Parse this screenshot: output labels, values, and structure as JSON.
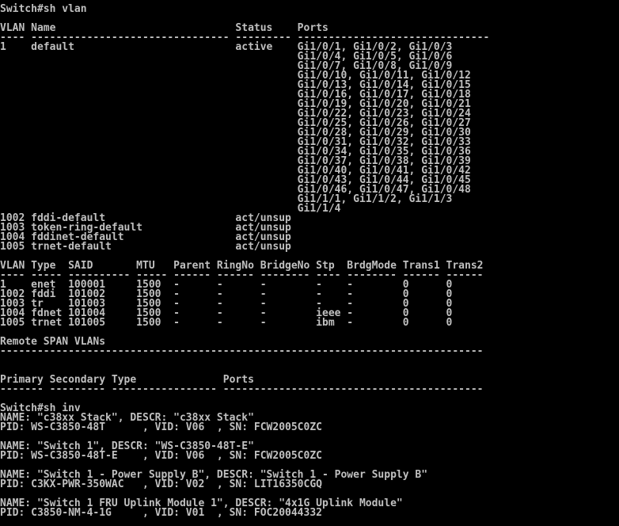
{
  "terminal": {
    "foreground": "#c0c0c0",
    "background": "#000000",
    "lines": [
      "Switch#sh vlan",
      "",
      "VLAN Name                             Status    Ports",
      "---- -------------------------------- --------- -------------------------------",
      "1    default                          active    Gi1/0/1, Gi1/0/2, Gi1/0/3",
      "                                                Gi1/0/4, Gi1/0/5, Gi1/0/6",
      "                                                Gi1/0/7, Gi1/0/8, Gi1/0/9",
      "                                                Gi1/0/10, Gi1/0/11, Gi1/0/12",
      "                                                Gi1/0/13, Gi1/0/14, Gi1/0/15",
      "                                                Gi1/0/16, Gi1/0/17, Gi1/0/18",
      "                                                Gi1/0/19, Gi1/0/20, Gi1/0/21",
      "                                                Gi1/0/22, Gi1/0/23, Gi1/0/24",
      "                                                Gi1/0/25, Gi1/0/26, Gi1/0/27",
      "                                                Gi1/0/28, Gi1/0/29, Gi1/0/30",
      "                                                Gi1/0/31, Gi1/0/32, Gi1/0/33",
      "                                                Gi1/0/34, Gi1/0/35, Gi1/0/36",
      "                                                Gi1/0/37, Gi1/0/38, Gi1/0/39",
      "                                                Gi1/0/40, Gi1/0/41, Gi1/0/42",
      "                                                Gi1/0/43, Gi1/0/44, Gi1/0/45",
      "                                                Gi1/0/46, Gi1/0/47, Gi1/0/48",
      "                                                Gi1/1/1, Gi1/1/2, Gi1/1/3",
      "                                                Gi1/1/4",
      "1002 fddi-default                     act/unsup",
      "1003 token-ring-default               act/unsup",
      "1004 fddinet-default                  act/unsup",
      "1005 trnet-default                    act/unsup",
      "",
      "VLAN Type  SAID       MTU   Parent RingNo BridgeNo Stp  BrdgMode Trans1 Trans2",
      "---- ----- ---------- ----- ------ ------ -------- ---- -------- ------ ------",
      "1    enet  100001     1500  -      -      -        -    -        0      0",
      "1002 fddi  101002     1500  -      -      -        -    -        0      0",
      "1003 tr    101003     1500  -      -      -        -    -        0      0",
      "1004 fdnet 101004     1500  -      -      -        ieee -        0      0",
      "1005 trnet 101005     1500  -      -      -        ibm  -        0      0",
      "",
      "Remote SPAN VLANs",
      "------------------------------------------------------------------------------",
      "",
      "",
      "Primary Secondary Type              Ports",
      "------- --------- ----------------- ------------------------------------------",
      "",
      "Switch#sh inv",
      "NAME: \"c38xx Stack\", DESCR: \"c38xx Stack\"",
      "PID: WS-C3850-48T      , VID: V06  , SN: FCW2005C0ZC",
      "",
      "NAME: \"Switch 1\", DESCR: \"WS-C3850-48T-E\"",
      "PID: WS-C3850-48T-E    , VID: V06  , SN: FCW2005C0ZC",
      "",
      "NAME: \"Switch 1 - Power Supply B\", DESCR: \"Switch 1 - Power Supply B\"",
      "PID: C3KX-PWR-350WAC   , VID: V02  , SN: LIT16350CGQ",
      "",
      "NAME: \"Switch 1 FRU Uplink Module 1\", DESCR: \"4x1G Uplink Module\"",
      "PID: C3850-NM-4-1G     , VID: V01  , SN: FOC20044332"
    ]
  }
}
